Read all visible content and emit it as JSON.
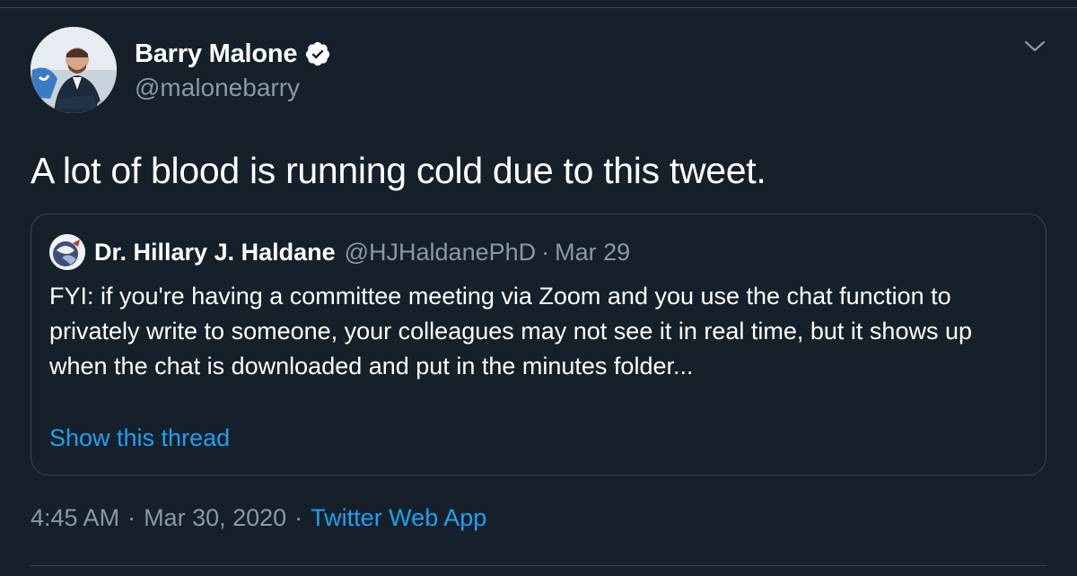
{
  "tweet": {
    "author_name": "Barry Malone",
    "author_handle": "@malonebarry",
    "text": "A lot of blood is running cold due to this tweet.",
    "time": "4:45 AM",
    "date": "Mar 30, 2020",
    "source": "Twitter Web App",
    "separator": "·"
  },
  "quoted_tweet": {
    "author_name": "Dr. Hillary J. Haldane",
    "author_handle": "@HJHaldanePhD",
    "separator": "·",
    "date": "Mar 29",
    "text": "FYI: if you're having a committee meeting via Zoom and you use the chat function to privately write to someone, your colleagues may not see it in real time, but it shows up when the chat is downloaded and put in the minutes folder...",
    "show_thread_label": "Show this thread"
  },
  "icons": {
    "verified": "verified-badge-icon",
    "menu": "chevron-down-icon"
  },
  "colors": {
    "background": "#15202b",
    "border": "#38444d",
    "secondary_text": "#8899a6",
    "link": "#1da1f2",
    "primary_text": "#ffffff"
  }
}
